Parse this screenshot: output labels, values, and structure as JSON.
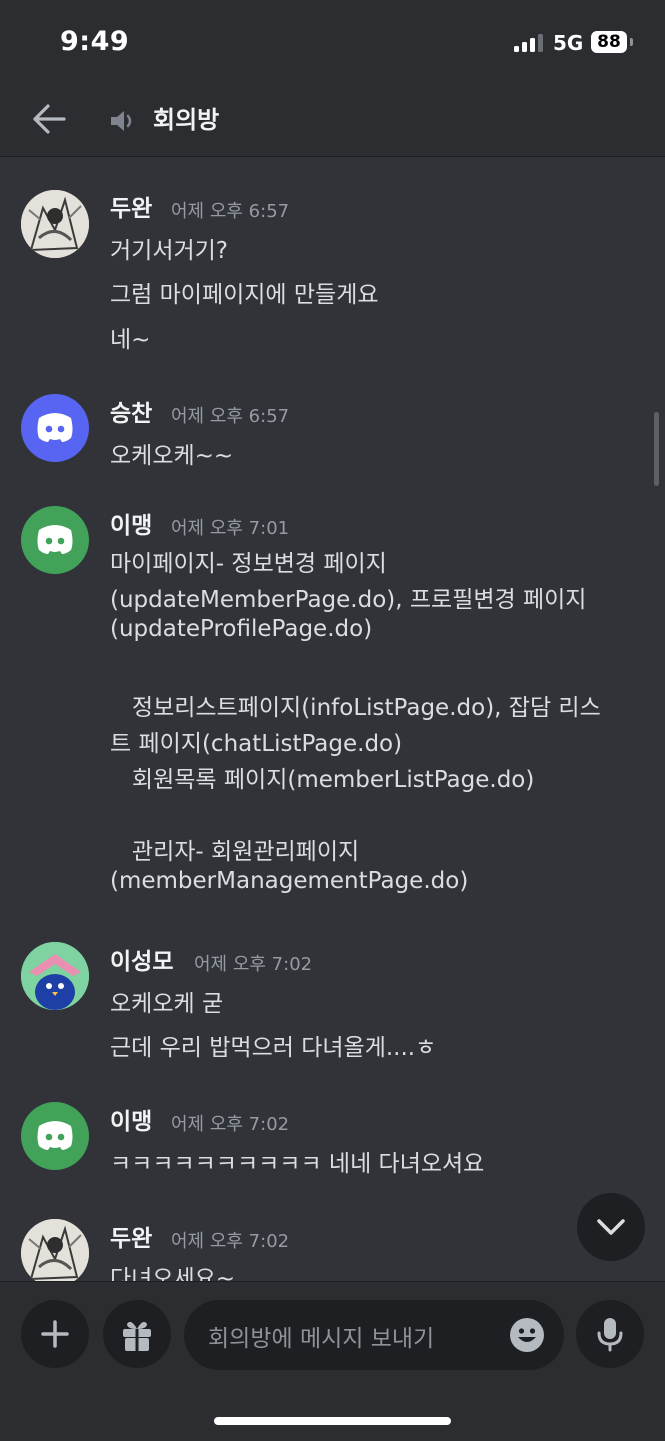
{
  "status_bar": {
    "time": "9:49",
    "network": "5G",
    "battery": "88"
  },
  "header": {
    "channel_name": "회의방",
    "back_icon": "arrow-left-icon",
    "channel_icon": "speaker-icon"
  },
  "messages": [
    {
      "author": "두완",
      "timestamp": "어제 오후 6:57",
      "avatar": "anime-sketch-avatar",
      "lines": [
        "거기서거기?",
        "그럼 마이페이지에 만들게요",
        "네~"
      ]
    },
    {
      "author": "승찬",
      "timestamp": "어제 오후 6:57",
      "avatar": "discord-default-avatar-blurple",
      "lines": [
        "오케오케~~"
      ]
    },
    {
      "author": "이맹",
      "timestamp": "어제 오후 7:01",
      "avatar": "discord-default-avatar-green",
      "lines": [
        "마이페이지- 정보변경 페이지",
        "(updateMemberPage.do), 프로필변경 페이지",
        "(updateProfilePage.do)",
        "",
        "   정보리스트페이지(infoListPage.do), 잡담 리스",
        "트 페이지(chatListPage.do)",
        "   회원목록 페이지(memberListPage.do)",
        "",
        "   관리자- 회원관리페이지",
        "(memberManagementPage.do)"
      ]
    },
    {
      "author": "이성모",
      "timestamp": "어제 오후 7:02",
      "avatar": "blue-bird-pink-hat-avatar",
      "lines": [
        "오케오케 굳",
        "근데 우리 밥먹으러 다녀올게....ㅎ"
      ]
    },
    {
      "author": "이맹",
      "timestamp": "어제 오후 7:02",
      "avatar": "discord-default-avatar-green",
      "lines": [
        "ㅋㅋㅋㅋㅋㅋㅋㅋㅋㅋ 네네 다녀오셔요"
      ]
    },
    {
      "author": "두완",
      "timestamp": "어제 오후 7:02",
      "avatar": "anime-sketch-avatar",
      "lines": [
        "다녀오세요~"
      ]
    }
  ],
  "composer": {
    "placeholder": "회의방에 메시지 보내기",
    "add_icon": "plus-icon",
    "gift_icon": "gift-icon",
    "emoji_icon": "emoji-icon",
    "mic_icon": "microphone-icon"
  },
  "jump_button_icon": "chevron-down-icon",
  "colors": {
    "background": "#313338",
    "header": "#2b2d31",
    "blurple": "#5865f2",
    "green": "#43a25a",
    "timestamp": "#949ba4"
  }
}
